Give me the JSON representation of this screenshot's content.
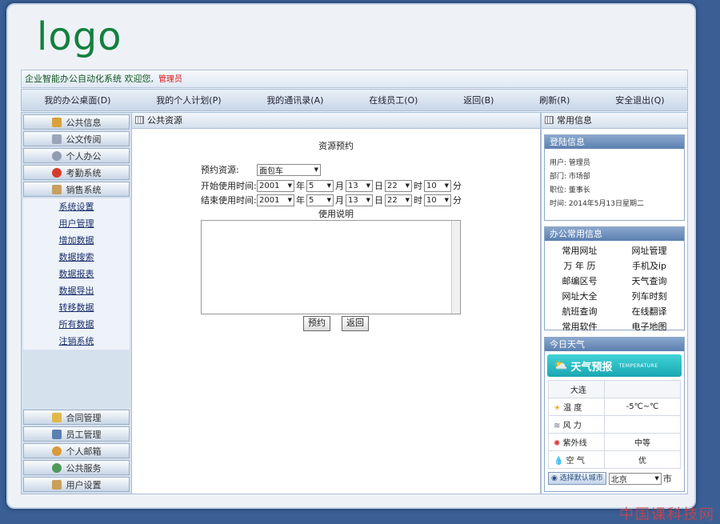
{
  "logo": "logo",
  "header": {
    "system_name": "企业智能办公自动化系统 欢迎您,",
    "user": "管理员"
  },
  "menu": [
    "我的办公桌面(D)",
    "我的个人计划(P)",
    "我的通讯录(A)",
    "在线员工(O)",
    "返回(B)",
    "刷新(R)",
    "安全退出(Q)"
  ],
  "sidebar": {
    "top": [
      "公共信息",
      "公文传阅",
      "个人办公",
      "考勤系统",
      "销售系统"
    ],
    "sub": [
      "系统设置",
      "用户管理",
      "增加数据",
      "数据搜索",
      "数据报表",
      "数据导出",
      "转移数据",
      "所有数据",
      "注销系统"
    ],
    "bottom": [
      "合同管理",
      "员工管理",
      "个人邮箱",
      "公共服务",
      "用户设置"
    ],
    "icon_colors": [
      "#d8a13a",
      "#9aa6b8",
      "#8f9cb2",
      "#d63b2a",
      "#c8a060"
    ]
  },
  "center": {
    "title": "公共资源",
    "form_title": "资源预约",
    "resource_label": "预约资源:",
    "resource_value": "面包车",
    "start_label": "开始使用时间:",
    "end_label": "结束使用时间:",
    "start": {
      "year": "2001",
      "month": "5",
      "day": "13",
      "hour": "22",
      "minute": "10"
    },
    "end": {
      "year": "2001",
      "month": "5",
      "day": "13",
      "hour": "22",
      "minute": "10"
    },
    "units": {
      "year": "年",
      "month": "月",
      "day": "日",
      "hour": "时",
      "minute": "分"
    },
    "desc_label": "使用说明",
    "reserve_button": "预约",
    "back_button": "返回"
  },
  "right": {
    "title": "常用信息",
    "login": {
      "title": "登陆信息",
      "user": "用户: 管理员",
      "dept": "部门: 市场部",
      "post": "职位: 董事长",
      "time": "时间: 2014年5月13日星期二"
    },
    "common": {
      "title": "办公常用信息",
      "links": [
        "常用网址",
        "网址管理",
        "万 年 历",
        "手机及ip",
        "邮编区号",
        "天气查询",
        "网址大全",
        "列车时刻",
        "航班查询",
        "在线翻译",
        "常用软件",
        "电子地图"
      ]
    },
    "weather": {
      "title": "今日天气",
      "banner": "天气预报",
      "banner_sub": "TEMPERATURE",
      "city": "大连",
      "rows": [
        {
          "label": "温  度",
          "value": "-5℃~℃"
        },
        {
          "label": "风  力",
          "value": ""
        },
        {
          "label": "紫外线",
          "value": "中等"
        },
        {
          "label": "空  气",
          "value": "优"
        }
      ],
      "choose_city": "选择默认城市",
      "selected_city": "北京",
      "city_suffix": "市"
    }
  },
  "watermark": "中国课科技网"
}
